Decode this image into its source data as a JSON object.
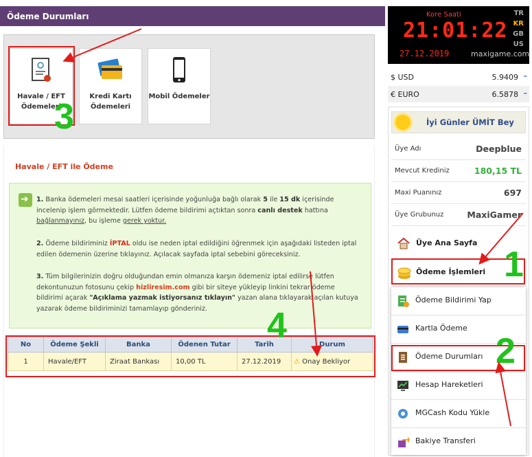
{
  "header": {
    "title": "Ödeme Durumları"
  },
  "payment_methods": [
    {
      "label": "Havale / EFT Ödemeleri",
      "icon": "bank-document-icon"
    },
    {
      "label": "Kredi Kartı Ödemeleri",
      "icon": "credit-card-icon"
    },
    {
      "label": "Mobil Ödemeler",
      "icon": "mobile-phone-icon"
    }
  ],
  "section": {
    "title": "Havale / EFT ile Ödeme"
  },
  "info": {
    "p1": {
      "a": "1.",
      "b": " Banka ödemeleri mesai saatleri içerisinde yoğunluğa bağlı olarak ",
      "c": "5",
      "d": " ile ",
      "e": "15 dk",
      "f": " içerisinde incelenip işlem görmektedir. Lütfen ödeme bildirimi açtıktan sonra ",
      "g": "canlı destek",
      "h": " hattına ",
      "i": "bağlanmayınız",
      "j": ", bu işleme ",
      "k": "gerek yoktur."
    },
    "p2": {
      "a": "2.",
      "b": " Ödeme bildiriminiz ",
      "c": "İPTAL",
      "d": " oldu ise neden iptal edildiğini öğrenmek için aşağıdaki listeden iptal edilen ödemenin üzerine tıklayınız. Açılacak sayfada iptal sebebini göreceksiniz."
    },
    "p3": {
      "a": "3.",
      "b": " Tüm bilgilerinizin doğru olduğundan emin olmanıza karşın ödemeniz iptal edilirse lütfen dekontunuzun fotosunu çekip ",
      "c": "hizliresim.com",
      "d": " gibi bir siteye yükleyip linkini tekrar ödeme bildirimi açarak ",
      "e": "\"Açıklama yazmak istiyorsanız tıklayın\"",
      "f": " yazan alana tıklayarak açılan kutuya yazarak ödeme bildiriminizi tamamlayıp gönderiniz."
    }
  },
  "table": {
    "headers": [
      "No",
      "Ödeme Şekli",
      "Banka",
      "Ödenen Tutar",
      "Tarih",
      "Durum"
    ],
    "rows": [
      {
        "no": "1",
        "method": "Havale/EFT",
        "bank": "Ziraat Bankası",
        "amount": "10,00 TL",
        "date": "27.12.2019",
        "status": "Onay Bekliyor"
      }
    ]
  },
  "clock": {
    "title": "Kore Saati",
    "time": "21:01:22",
    "date": "27.12.2019",
    "brand": "maxigame.com",
    "langs": [
      "TR",
      "KR",
      "GB",
      "US"
    ],
    "active_lang": "KR"
  },
  "rates": [
    {
      "label": "$ USD",
      "value": "5.9409"
    },
    {
      "label": "€ EURO",
      "value": "6.5878"
    }
  ],
  "user": {
    "greeting": "İyi Günler ÜMİT Bey",
    "fields": [
      {
        "label": "Üye Adı",
        "value": "Deepblue"
      },
      {
        "label": "Mevcut Krediniz",
        "value": "180,15 TL"
      },
      {
        "label": "Maxi Puanınız",
        "value": "697"
      },
      {
        "label": "Üye Grubunuz",
        "value": "MaxiGamer"
      }
    ]
  },
  "menu": {
    "home": "Üye Ana Sayfa",
    "payments": "Ödeme İşlemleri",
    "submenu": [
      "Ödeme Bildirimi Yap",
      "Kartla Ödeme",
      "Ödeme Durumları",
      "Hesap Hareketleri",
      "MGCash Kodu Yükle",
      "Bakiye Transferi"
    ]
  },
  "annotations": {
    "steps": [
      "1",
      "2",
      "3",
      "4"
    ]
  },
  "colors": {
    "header": "#5f3f73",
    "highlight": "#e21b1b",
    "step_green": "#21c21d",
    "credit_green": "#35b03b",
    "info_bg": "#ecf9dc"
  }
}
